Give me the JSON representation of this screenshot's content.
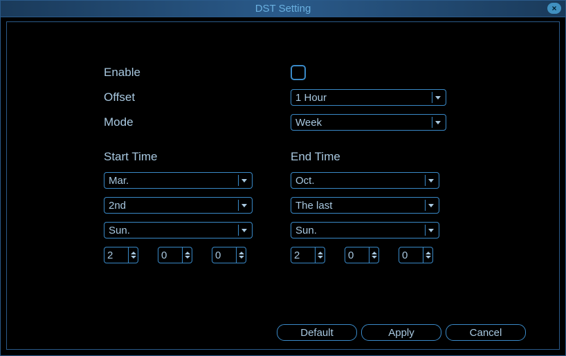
{
  "title": "DST Setting",
  "close_icon": "×",
  "labels": {
    "enable": "Enable",
    "offset": "Offset",
    "mode": "Mode",
    "start_time": "Start Time",
    "end_time": "End Time"
  },
  "fields": {
    "enable": false,
    "offset": "1 Hour",
    "mode": "Week",
    "start": {
      "month": "Mar.",
      "week": "2nd",
      "day": "Sun.",
      "hour": "2",
      "minute": "0",
      "second": "0"
    },
    "end": {
      "month": "Oct.",
      "week": "The last",
      "day": "Sun.",
      "hour": "2",
      "minute": "0",
      "second": "0"
    }
  },
  "buttons": {
    "default": "Default",
    "apply": "Apply",
    "cancel": "Cancel"
  }
}
